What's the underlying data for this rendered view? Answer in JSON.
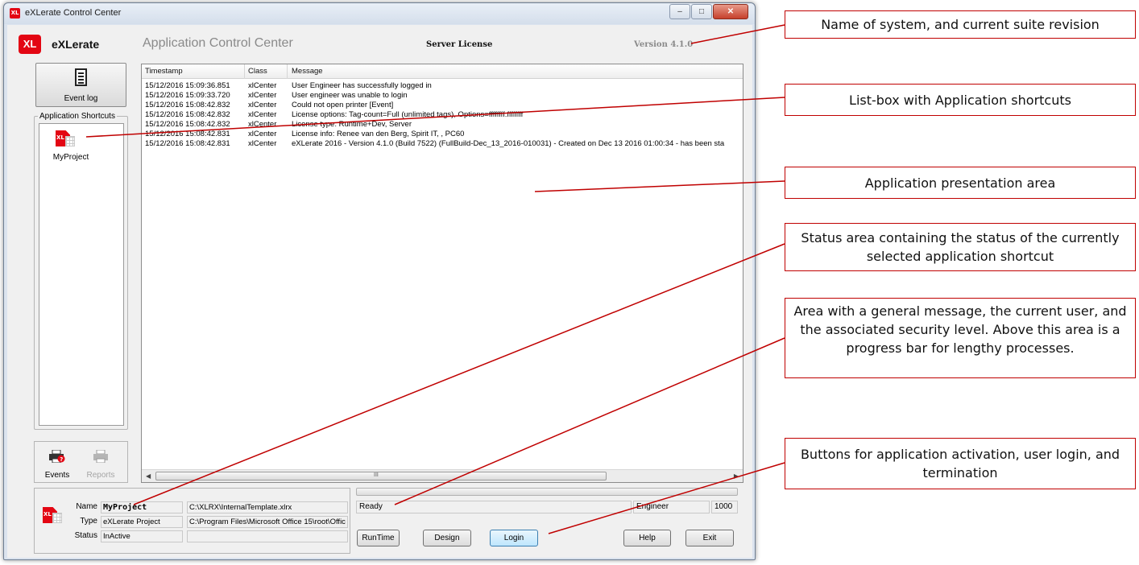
{
  "window": {
    "title": "eXLerate Control Center",
    "buttons": [
      "minimize",
      "maximize",
      "close"
    ]
  },
  "header": {
    "logo_text": "XL",
    "brand": "eXLerate",
    "title": "Application Control Center",
    "license": "Server License",
    "version": "Version 4.1.0"
  },
  "sidebar": {
    "event_log_label": "Event log",
    "shortcuts_legend": "Application Shortcuts",
    "shortcuts": [
      {
        "label": "MyProject",
        "icon": "excel-project-icon"
      }
    ],
    "tabs": [
      {
        "label": "Events",
        "icon": "events-icon",
        "enabled": true
      },
      {
        "label": "Reports",
        "icon": "printer-icon",
        "enabled": false
      }
    ]
  },
  "log": {
    "columns": [
      "Timestamp",
      "Class",
      "Message"
    ],
    "rows": [
      {
        "timestamp": "15/12/2016 15:09:36.851",
        "class": "xlCenter",
        "message": "User Engineer has successfully logged in"
      },
      {
        "timestamp": "15/12/2016 15:09:33.720",
        "class": "xlCenter",
        "message": "User engineer was unable to login"
      },
      {
        "timestamp": "15/12/2016 15:08:42.832",
        "class": "xlCenter",
        "message": "Could not open printer [Event]"
      },
      {
        "timestamp": "15/12/2016 15:08:42.832",
        "class": "xlCenter",
        "message": "License options: Tag-count=Full (unlimited tags), Options=ffffffff:ffffffff"
      },
      {
        "timestamp": "15/12/2016 15:08:42.832",
        "class": "xlCenter",
        "message": "License type: Runtime+Dev, Server"
      },
      {
        "timestamp": "15/12/2016 15:08:42.831",
        "class": "xlCenter",
        "message": "License info: Renee van den Berg, Spirit IT, , PC60"
      },
      {
        "timestamp": "15/12/2016 15:08:42.831",
        "class": "xlCenter",
        "message": "eXLerate 2016 - Version 4.1.0 (Build 7522) (FullBuild-Dec_13_2016-010031) - Created on Dec 13 2016 01:00:34 - has been sta"
      }
    ],
    "scroll_grip": "III"
  },
  "status": {
    "name_label": "Name",
    "name_value": "MyProject",
    "name_path": "C:\\XLRX\\InternalTemplate.xlrx",
    "type_label": "Type",
    "type_value": "eXLerate Project",
    "type_path": "C:\\Program Files\\Microsoft Office 15\\root\\Offic",
    "status_label": "Status",
    "status_value": "InActive",
    "status_extra": ""
  },
  "message_bar": {
    "message": "Ready",
    "user": "Engineer",
    "level": "1000",
    "progress": 0
  },
  "buttons": {
    "runtime": "RunTime",
    "design": "Design",
    "login": "Login",
    "help": "Help",
    "exit": "Exit"
  },
  "annotations": [
    "Name of system, and current suite revision",
    "List-box with Application shortcuts",
    "Application presentation area",
    "Status area containing the status of the currently selected application shortcut",
    "Area with a general message, the current user, and the associated security level. Above this area is a progress bar for lengthy processes.",
    "Buttons for application activation, user login, and termination"
  ],
  "colors": {
    "brand_red": "#e30613",
    "annotation_border": "#c00000",
    "window_frame": "#dbe3ee",
    "client_bg": "#f0f0f0"
  }
}
